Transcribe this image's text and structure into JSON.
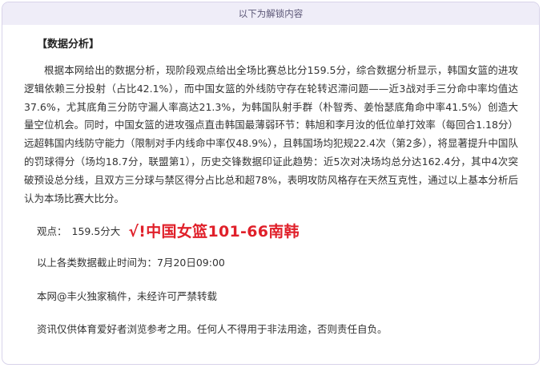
{
  "banner": {
    "text": "以下为解锁内容"
  },
  "article": {
    "section_title": "【数据分析】",
    "paragraph": "根据本网给出的数据分析，现阶段观点给出全场比赛总比分159.5分，综合数据分析显示，韩国女篮的进攻逻辑依赖三分投射（占比42.1%），而中国女篮的外线防守存在轮转迟滞问题——近3战对手三分命中率均值达37.6%，尤其底角三分防守漏人率高达21.3%，为韩国队射手群（朴智秀、姜怡瑟底角命中率41.5%）创造大量空位机会。同时，中国女篮的进攻强点直击韩国最薄弱环节：韩旭和李月汝的低位单打效率（每回合1.18分）远超韩国内线防守能力（限制对手内线命中率仅48.9%），且韩国场均犯规22.4次（第2多），将显著提升中国队的罚球得分（场均18.7分，联盟第1），历史交锋数据印证此趋势：近5次对决场均总分达162.4分，其中4次突破预设总分线，且双方三分球与禁区得分占比总和超78%，表明攻防风格存在天然互克性，通过以上基本分析后认为本场比赛大比分。",
    "viewpoint_label": "观点：",
    "viewpoint_value": "159.5分大",
    "result": "√!中国女篮101-66南韩",
    "deadline": "以上各类数据截止时间为：7月20日09:00",
    "copyright": "本网@丰火独家稿件，未经许可严禁转载",
    "disclaimer": "资讯仅供体育爱好者浏览参考之用。任何人不得用于非法用途，否则责任自负。"
  },
  "colors": {
    "banner_bg": "#efedf8",
    "frame_border": "#d8d3ea",
    "result_red": "#e0202a"
  }
}
